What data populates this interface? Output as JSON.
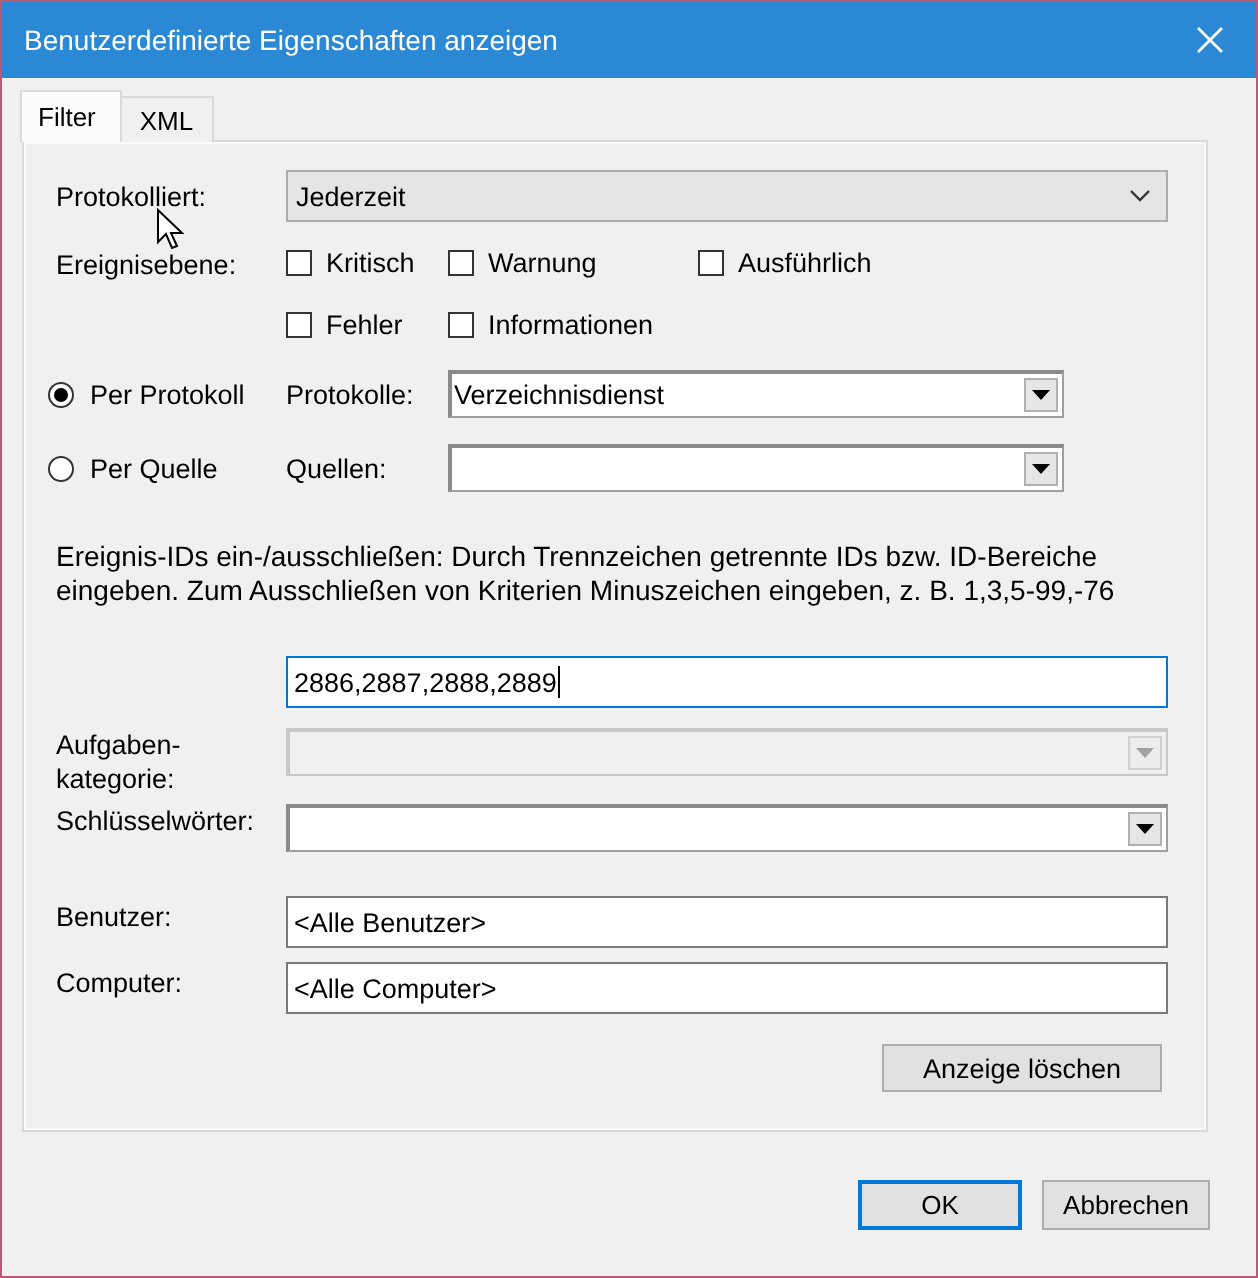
{
  "window": {
    "title": "Benutzerdefinierte Eigenschaften anzeigen"
  },
  "tabs": [
    {
      "label": "Filter",
      "selected": true
    },
    {
      "label": "XML",
      "selected": false
    }
  ],
  "filter": {
    "logged": {
      "label": "Protokolliert:",
      "kind": "modern",
      "value": "Jederzeit"
    },
    "event_level": {
      "label": "Ereignisebene:",
      "levels": [
        {
          "label": "Kritisch",
          "checked": false
        },
        {
          "label": "Warnung",
          "checked": false
        },
        {
          "label": "Ausführlich",
          "checked": false
        },
        {
          "label": "Fehler",
          "checked": false
        },
        {
          "label": "Informationen",
          "checked": false
        }
      ]
    },
    "sources": [
      {
        "label": "Per Protokoll",
        "selected": true,
        "field_label": "Protokolle:",
        "kind": "classic",
        "value": "Verzeichnisdienst"
      },
      {
        "label": "Per Quelle",
        "selected": false,
        "field_label": "Quellen:",
        "kind": "classic"
      }
    ],
    "description": "Ereignis-IDs ein-/ausschließen: Durch Trennzeichen getrennte IDs bzw. ID-Bereiche eingeben. Zum Ausschließen von Kriterien Minuszeichen eingeben, z. B. 1,3,5-99,-76",
    "event_ids": {
      "value": "2886,2887,2888,2889",
      "focused": true
    },
    "task_category": {
      "label": "Aufgaben-\nkategorie:",
      "kind": "classic",
      "disabled": true
    },
    "keywords": {
      "label": "Schlüsselwörter:",
      "kind": "classic",
      "disabled": false
    },
    "user": {
      "label": "Benutzer:",
      "value": "<Alle Benutzer>"
    },
    "computer": {
      "label": "Computer:",
      "value": "<Alle Computer>"
    },
    "clear_button": "Anzeige löschen"
  },
  "buttons": [
    {
      "label": "OK",
      "default": true
    },
    {
      "label": "Abbrechen",
      "default": false
    }
  ]
}
